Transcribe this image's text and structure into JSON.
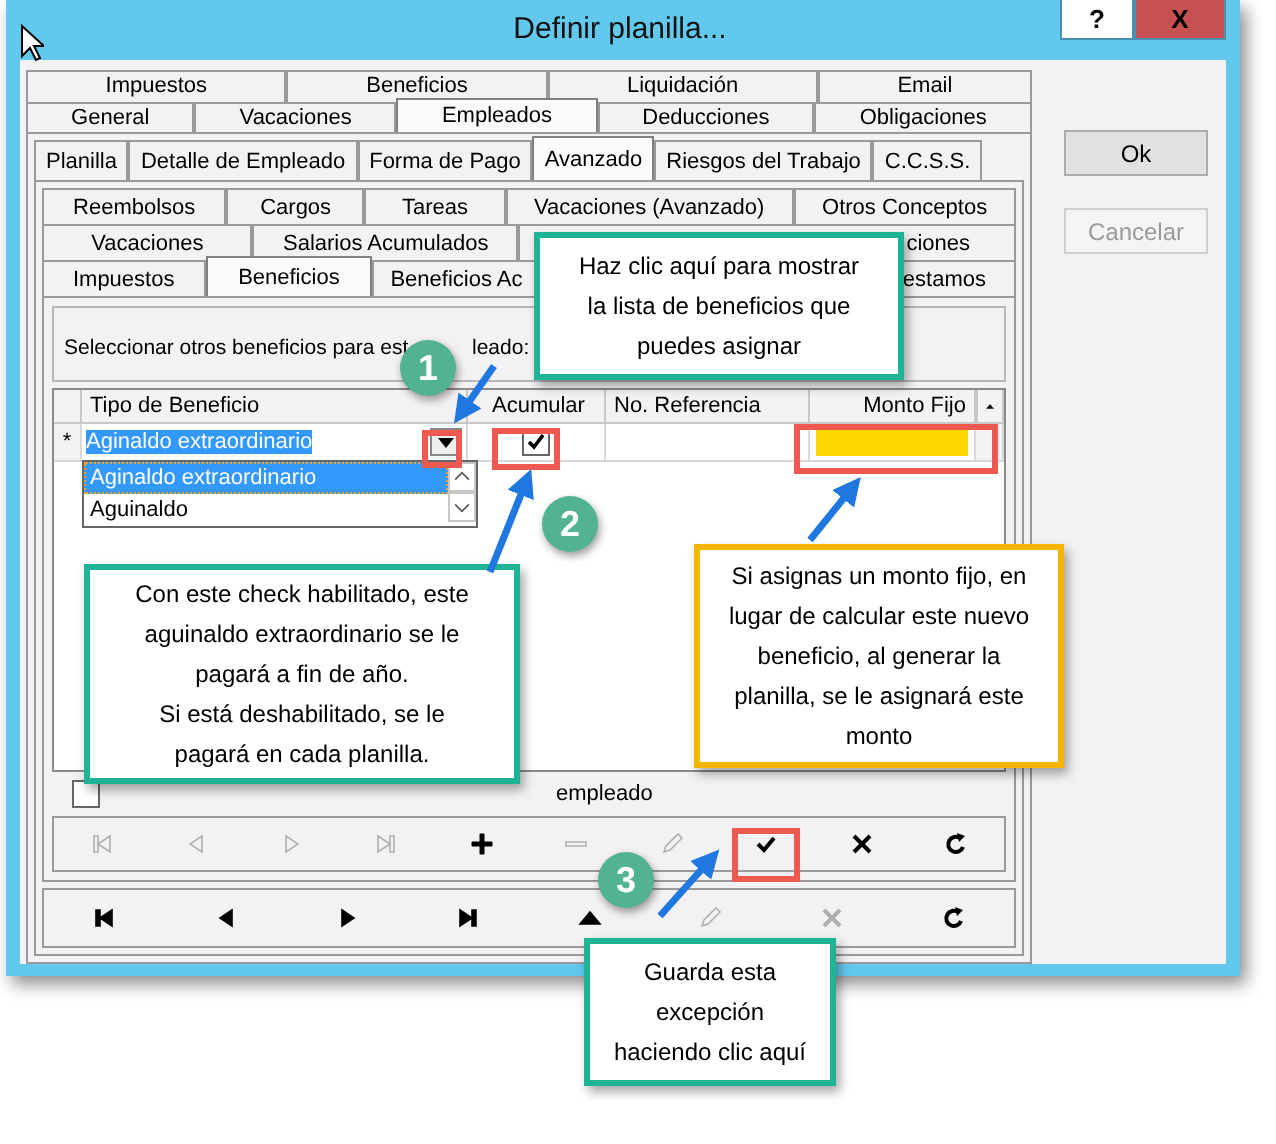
{
  "window": {
    "title": "Definir planilla...",
    "help": "?",
    "close": "X"
  },
  "main_tab_rows": [
    {
      "tabs": [
        {
          "label": "Impuestos",
          "selected": false
        },
        {
          "label": "Beneficios",
          "selected": false
        },
        {
          "label": "Liquidación",
          "selected": false
        },
        {
          "label": "Email",
          "selected": false
        }
      ]
    },
    {
      "tabs": [
        {
          "label": "General",
          "selected": false
        },
        {
          "label": "Vacaciones",
          "selected": false
        },
        {
          "label": "Empleados",
          "selected": true
        },
        {
          "label": "Deducciones",
          "selected": false
        },
        {
          "label": "Obligaciones",
          "selected": false
        }
      ]
    }
  ],
  "employee_tabs": [
    {
      "label": "Planilla",
      "selected": false
    },
    {
      "label": "Detalle de Empleado",
      "selected": false
    },
    {
      "label": "Forma de Pago",
      "selected": false
    },
    {
      "label": "Avanzado",
      "selected": true
    },
    {
      "label": "Riesgos del Trabajo",
      "selected": false
    },
    {
      "label": "C.C.S.S.",
      "selected": false
    }
  ],
  "advanced_tab_rows": [
    {
      "tabs": [
        {
          "label": "Reembolsos",
          "selected": false
        },
        {
          "label": "Cargos",
          "selected": false
        },
        {
          "label": "Tareas",
          "selected": false
        },
        {
          "label": "Vacaciones (Avanzado)",
          "selected": false
        },
        {
          "label": "Otros Conceptos",
          "selected": false
        }
      ]
    },
    {
      "tabs": [
        {
          "label": "Vacaciones",
          "selected": false
        },
        {
          "label": "Salarios Acumulados",
          "selected": false
        },
        {
          "label": "ciones",
          "selected": false
        }
      ]
    },
    {
      "tabs": [
        {
          "label": "Impuestos",
          "selected": false
        },
        {
          "label": "Beneficios",
          "selected": true
        },
        {
          "label": "Beneficios Ac",
          "selected": false
        },
        {
          "label": "estamos",
          "selected": false
        }
      ]
    }
  ],
  "instruction": [
    "Seleccionar otros beneficios para est",
    "leado:"
  ],
  "grid": {
    "columns": [
      "Tipo de Beneficio",
      "Acumular",
      "No. Referencia",
      "Monto Fijo"
    ],
    "rows": [
      {
        "indicator": "*",
        "tipo": "Aginaldo extraordinario",
        "selected": true,
        "acumular": true,
        "monto_highlighted": true
      }
    ]
  },
  "dropdown": {
    "items": [
      {
        "label": "Aginaldo extraordinario",
        "selected": true
      },
      {
        "label": "Aguinaldo",
        "selected": false
      }
    ]
  },
  "replace_default": {
    "checked": false,
    "label": "empleado"
  },
  "record_toolbar": [
    {
      "kind": "first",
      "disabled": true
    },
    {
      "kind": "prev",
      "disabled": true
    },
    {
      "kind": "next",
      "disabled": true
    },
    {
      "kind": "last",
      "disabled": true
    },
    {
      "kind": "insert",
      "disabled": false
    },
    {
      "kind": "delete",
      "disabled": true
    },
    {
      "kind": "edit",
      "disabled": true
    },
    {
      "kind": "post",
      "disabled": false
    },
    {
      "kind": "cancel",
      "disabled": false
    },
    {
      "kind": "refresh",
      "disabled": false
    }
  ],
  "dialog_toolbar": [
    {
      "kind": "first",
      "disabled": false
    },
    {
      "kind": "prev",
      "disabled": false
    },
    {
      "kind": "next",
      "disabled": false
    },
    {
      "kind": "last",
      "disabled": false
    },
    {
      "kind": "up",
      "disabled": false
    },
    {
      "kind": "edit",
      "disabled": true
    },
    {
      "kind": "cancel",
      "disabled": true
    },
    {
      "kind": "refresh",
      "disabled": false
    }
  ],
  "side_buttons": [
    {
      "label": "Ok",
      "disabled": false
    },
    {
      "label": "Cancelar",
      "disabled": true
    }
  ],
  "callouts": [
    {
      "text": [
        "Haz clic aquí para mostrar la lista de beneficios que puedes asignar"
      ],
      "color": "#1db596"
    },
    {
      "text": [
        "Con este check habilitado, este aguinaldo extraordinario se le pagará a fin de año.",
        "Si está deshabilitado, se le pagará en cada planilla."
      ],
      "color": "#1db596"
    },
    {
      "text": [
        "Si asignas un monto fijo, en lugar de calcular este nuevo beneficio, al generar la planilla, se le asignará este monto"
      ],
      "color": "#f5b400"
    },
    {
      "text": [
        "Guarda esta excepción haciendo clic aquí"
      ],
      "color": "#1db596"
    }
  ],
  "steps": [
    "1",
    "2",
    "3"
  ]
}
